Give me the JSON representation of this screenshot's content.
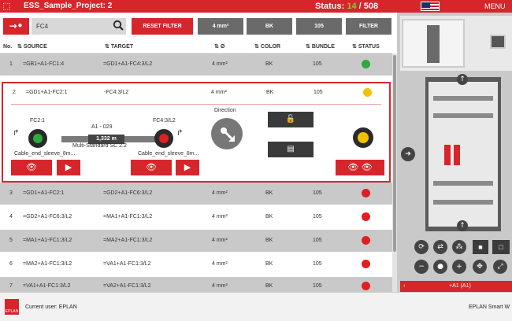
{
  "topbar": {
    "project": "ESS_Sample_Project: 2",
    "status_label": "Status:",
    "status_done": "14",
    "status_total": "/ 508",
    "menu": "MENU"
  },
  "filter": {
    "search_value": "FC4",
    "reset": "RESET FILTER",
    "chips": [
      "4 mm²",
      "BK",
      "105",
      "FILTER"
    ]
  },
  "columns": {
    "no": "No.",
    "source": "SOURCE",
    "target": "TARGET",
    "diam": "Ø",
    "color": "COLOR",
    "bundle": "BUNDLE",
    "status": "STATUS"
  },
  "rows": [
    {
      "no": "1",
      "source": "=GB1+A1-FC1:4",
      "target": "=GD1+A1-FC4:3/L2",
      "diam": "4 mm²",
      "color": "BK",
      "bundle": "105",
      "status": "#2eaa3f"
    },
    {
      "no": "2",
      "source": "=GD1+A1-FC2:1",
      "target": "-FC4:3/L2",
      "diam": "4 mm²",
      "color": "BK",
      "bundle": "105",
      "status": "#f2c200"
    },
    {
      "no": "3",
      "source": "=GD1+A1-FC2:1",
      "target": "=GD2+A1-FC6:3/L2",
      "diam": "4 mm²",
      "color": "BK",
      "bundle": "105",
      "status": "#e02020"
    },
    {
      "no": "4",
      "source": "=GD2+A1-FC6:3/L2",
      "target": "=MA1+A1-FC1:3/L2",
      "diam": "4 mm²",
      "color": "BK",
      "bundle": "105",
      "status": "#e02020"
    },
    {
      "no": "5",
      "source": "=MA1+A1-FC1:3/L2",
      "target": "=MA2+A1-FC1:3/L2",
      "diam": "4 mm²",
      "color": "BK",
      "bundle": "105",
      "status": "#e02020"
    },
    {
      "no": "6",
      "source": "=MA2+A1-FC1:3/L2",
      "target": "=VA1+A1-FC1:3/L2",
      "diam": "4 mm²",
      "color": "BK",
      "bundle": "105",
      "status": "#e02020"
    },
    {
      "no": "7",
      "source": "=VA1+A1-FC1:3/L2",
      "target": "=VA2+A1-FC1:3/L2",
      "diam": "4 mm²",
      "color": "BK",
      "bundle": "105",
      "status": "#e02020"
    }
  ],
  "detail": {
    "from_label": "FC2:1",
    "to_label": "FC4:3/L2",
    "wire_id": "A1 - 029",
    "length": "1,332 m",
    "wire_type": "Multi-Standard SC 2.2",
    "from_end": "Cable_end_sleeve_8m...",
    "to_end": "Cable_end_sleeve_8m...",
    "direction": "Direction"
  },
  "right_panel": {
    "location": "+A1 (A1)"
  },
  "footer": {
    "user": "Current user: EPLAN",
    "brand": "EPLAN Smart W",
    "logo": "EPLAN"
  }
}
